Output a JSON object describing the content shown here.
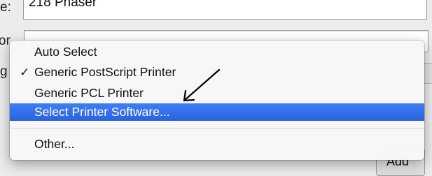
{
  "form": {
    "name_label": "e:",
    "name_value": "218 Phaser",
    "location_label_fragment": "or",
    "use_label_fragment": "g",
    "add_button_label": "Add"
  },
  "popup_menu": {
    "items": [
      {
        "label": "Auto Select",
        "checked": false,
        "selected": false
      },
      {
        "label": "Generic PostScript Printer",
        "checked": true,
        "selected": false
      },
      {
        "label": "Generic PCL Printer",
        "checked": false,
        "selected": false
      },
      {
        "label": "Select Printer Software...",
        "checked": false,
        "selected": true
      },
      {
        "label": "Other...",
        "checked": false,
        "selected": false
      }
    ],
    "check_glyph": "✓"
  },
  "colors": {
    "selection": "#2f6ee8",
    "menu_background": "#f7f7f7",
    "window_background": "#ececec",
    "annotation_arrow": "#000000"
  }
}
